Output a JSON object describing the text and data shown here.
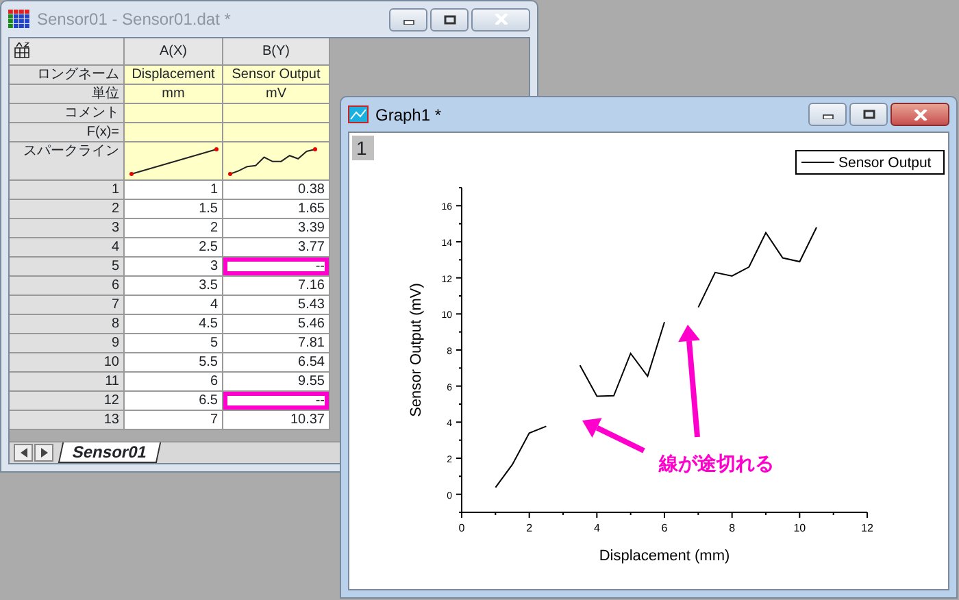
{
  "worksheet_window": {
    "title": "Sensor01 - Sensor01.dat *",
    "active": false,
    "columns": [
      {
        "header": "A(X)",
        "long_name": "Displacement",
        "units": "mm"
      },
      {
        "header": "B(Y)",
        "long_name": "Sensor Output",
        "units": "mV"
      }
    ],
    "row_labels": [
      "ロングネーム",
      "単位",
      "コメント",
      "F(x)=",
      "スパークライン"
    ],
    "rows": [
      {
        "index": "1",
        "cells": [
          "1",
          "0.38"
        ],
        "highlighted": false
      },
      {
        "index": "2",
        "cells": [
          "1.5",
          "1.65"
        ],
        "highlighted": false
      },
      {
        "index": "3",
        "cells": [
          "2",
          "3.39"
        ],
        "highlighted": false
      },
      {
        "index": "4",
        "cells": [
          "2.5",
          "3.77"
        ],
        "highlighted": false
      },
      {
        "index": "5",
        "cells": [
          "3",
          "--"
        ],
        "highlighted": true
      },
      {
        "index": "6",
        "cells": [
          "3.5",
          "7.16"
        ],
        "highlighted": false
      },
      {
        "index": "7",
        "cells": [
          "4",
          "5.43"
        ],
        "highlighted": false
      },
      {
        "index": "8",
        "cells": [
          "4.5",
          "5.46"
        ],
        "highlighted": false
      },
      {
        "index": "9",
        "cells": [
          "5",
          "7.81"
        ],
        "highlighted": false
      },
      {
        "index": "10",
        "cells": [
          "5.5",
          "6.54"
        ],
        "highlighted": false
      },
      {
        "index": "11",
        "cells": [
          "6",
          "9.55"
        ],
        "highlighted": false
      },
      {
        "index": "12",
        "cells": [
          "6.5",
          "--"
        ],
        "highlighted": true
      },
      {
        "index": "13",
        "cells": [
          "7",
          "10.37"
        ],
        "highlighted": false
      }
    ],
    "sheet_tabs": [
      {
        "label": "Sensor01",
        "selected": true
      }
    ]
  },
  "graph_window": {
    "title": "Graph1 *",
    "active": true,
    "layer_label": "1",
    "chart_data": {
      "type": "line",
      "xlabel": "Displacement (mm)",
      "ylabel": "Sensor Output (mV)",
      "x": [
        1,
        1.5,
        2,
        2.5,
        3,
        3.5,
        4,
        4.5,
        5,
        5.5,
        6,
        6.5,
        7,
        7.5,
        8,
        8.5,
        9,
        9.5,
        10,
        10.5
      ],
      "series": [
        {
          "name": "Sensor Output",
          "color": "#000000",
          "values": [
            0.38,
            1.65,
            3.39,
            3.77,
            null,
            7.16,
            5.43,
            5.46,
            7.81,
            6.54,
            9.55,
            null,
            10.37,
            12.3,
            12.1,
            12.6,
            14.5,
            13.1,
            12.9,
            14.8
          ]
        }
      ],
      "xlim": [
        0,
        12
      ],
      "ylim": [
        -1,
        17
      ],
      "xticks": [
        0,
        2,
        4,
        6,
        8,
        10,
        12
      ],
      "yticks": [
        0,
        2,
        4,
        6,
        8,
        10,
        12,
        14,
        16
      ],
      "annotations": [
        "線が途切れる"
      ]
    }
  }
}
